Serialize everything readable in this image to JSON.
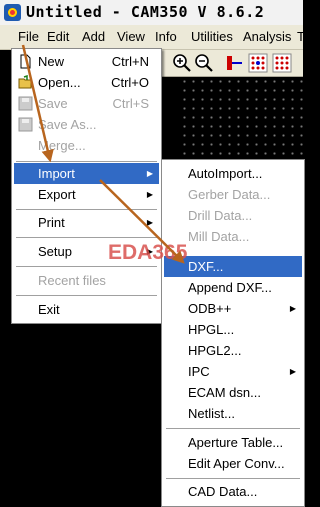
{
  "title": "Untitled - CAM350 V 8.6.2",
  "menubar": [
    "File",
    "Edit",
    "Add",
    "View",
    "Info",
    "Utilities",
    "Analysis",
    "T"
  ],
  "file_menu": [
    {
      "label": "New",
      "shortcut": "Ctrl+N",
      "enabled": true,
      "icon": "new-file-icon"
    },
    {
      "label": "Open...",
      "shortcut": "Ctrl+O",
      "enabled": true,
      "icon": "open-folder-icon"
    },
    {
      "label": "Save",
      "shortcut": "Ctrl+S",
      "enabled": false,
      "icon": "save-icon"
    },
    {
      "label": "Save As...",
      "shortcut": "",
      "enabled": false,
      "icon": "save-as-icon"
    },
    {
      "label": "Merge...",
      "shortcut": "",
      "enabled": false
    },
    {
      "label": "Import",
      "shortcut": "",
      "enabled": true,
      "submenu": true,
      "highlighted": true
    },
    {
      "label": "Export",
      "shortcut": "",
      "enabled": true,
      "submenu": true
    },
    {
      "label": "Print",
      "shortcut": "",
      "enabled": true,
      "submenu": true
    },
    {
      "label": "Setup",
      "shortcut": "",
      "enabled": true,
      "submenu": true
    },
    {
      "label": "Recent files",
      "shortcut": "",
      "enabled": false
    },
    {
      "label": "Exit",
      "shortcut": "",
      "enabled": true
    }
  ],
  "import_menu": [
    {
      "label": "AutoImport...",
      "enabled": true
    },
    {
      "label": "Gerber Data...",
      "enabled": false
    },
    {
      "label": "Drill Data...",
      "enabled": false
    },
    {
      "label": "Mill Data...",
      "enabled": false
    },
    {
      "label": "DXF...",
      "enabled": true,
      "highlighted": true
    },
    {
      "label": "Append DXF...",
      "enabled": true
    },
    {
      "label": "ODB++",
      "enabled": true,
      "submenu": true
    },
    {
      "label": "HPGL...",
      "enabled": true
    },
    {
      "label": "HPGL2...",
      "enabled": true
    },
    {
      "label": "IPC",
      "enabled": true,
      "submenu": true
    },
    {
      "label": "ECAM dsn...",
      "enabled": true
    },
    {
      "label": "Netlist...",
      "enabled": true
    },
    {
      "label": "Aperture Table...",
      "enabled": true
    },
    {
      "label": "Edit Aper Conv...",
      "enabled": true
    },
    {
      "label": "CAD Data...",
      "enabled": true
    }
  ],
  "watermark": "EDA365",
  "colors": {
    "highlight": "#316ac5",
    "arrow": "#b8651e",
    "watermark": "#d9534f"
  }
}
